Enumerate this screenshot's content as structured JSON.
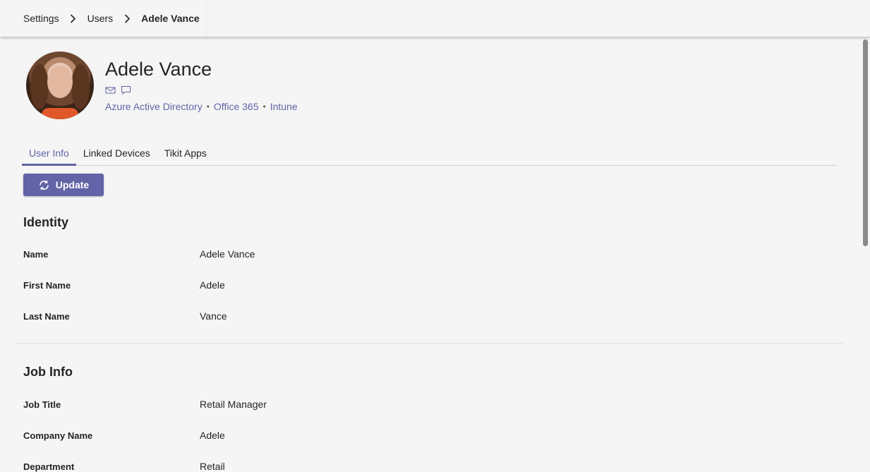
{
  "breadcrumb": {
    "items": [
      "Settings",
      "Users"
    ],
    "current": "Adele Vance"
  },
  "user": {
    "name": "Adele Vance",
    "contact_icons": [
      "mail-icon",
      "chat-icon"
    ],
    "sources": [
      "Azure Active Directory",
      "Office 365",
      "Intune"
    ]
  },
  "tabs": {
    "items": [
      "User Info",
      "Linked Devices",
      "Tikit Apps"
    ],
    "active": "User Info"
  },
  "update_button": {
    "label": "Update",
    "icon": "refresh-icon"
  },
  "identity": {
    "title": "Identity",
    "rows": [
      {
        "label": "Name",
        "value": "Adele Vance"
      },
      {
        "label": "First Name",
        "value": "Adele"
      },
      {
        "label": "Last Name",
        "value": "Vance"
      }
    ]
  },
  "job_info": {
    "title": "Job Info",
    "rows": [
      {
        "label": "Job Title",
        "value": "Retail Manager"
      },
      {
        "label": "Company Name",
        "value": "Adele"
      },
      {
        "label": "Department",
        "value": "Retail"
      }
    ]
  },
  "colors": {
    "accent": "#6264a7",
    "background": "#f5f5f5",
    "text": "#252423"
  }
}
